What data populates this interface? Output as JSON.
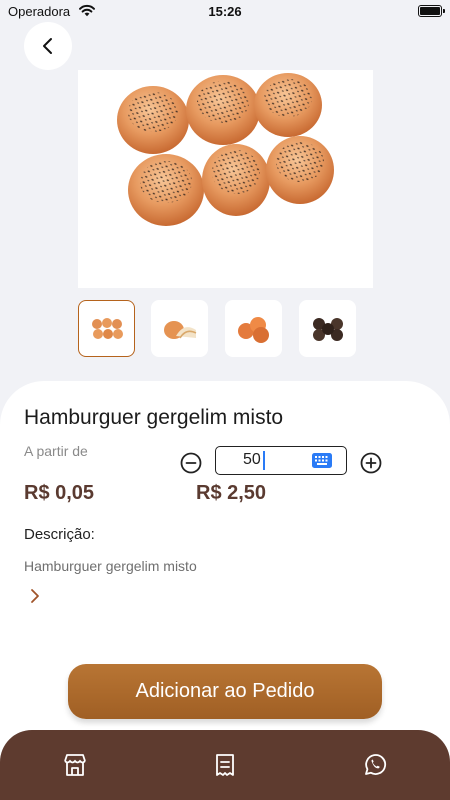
{
  "status_bar": {
    "carrier": "Operadora",
    "time": "15:26",
    "wifi_icon": "wifi-icon",
    "battery_icon": "battery-icon"
  },
  "header": {
    "back_icon": "chevron-left-icon"
  },
  "product": {
    "title": "Hamburguer gergelim misto",
    "price_label": "A partir de",
    "unit_price": "R$ 0,05",
    "total_price": "R$ 2,50",
    "images": [
      {
        "name": "burger-buns-grid",
        "selected": true
      },
      {
        "name": "bread-roll-cut",
        "selected": false
      },
      {
        "name": "orange-buns",
        "selected": false
      },
      {
        "name": "dark-sesame-buns",
        "selected": false
      }
    ]
  },
  "quantity": {
    "value": "50",
    "minus_icon": "minus-circle-icon",
    "plus_icon": "plus-circle-icon",
    "keyboard_icon": "keyboard-icon"
  },
  "description": {
    "heading": "Descrição:",
    "text": "Hamburguer gergelim misto",
    "expand_icon": "chevron-right-icon"
  },
  "actions": {
    "add_label": "Adicionar ao Pedido"
  },
  "bottom_nav": {
    "items": [
      {
        "icon": "store-icon"
      },
      {
        "icon": "receipt-icon"
      },
      {
        "icon": "whatsapp-icon"
      }
    ]
  },
  "colors": {
    "accent": "#a86528",
    "price": "#5a3a30",
    "nav_bg": "#5e3b2f",
    "page_bg": "#f1f2f6"
  }
}
